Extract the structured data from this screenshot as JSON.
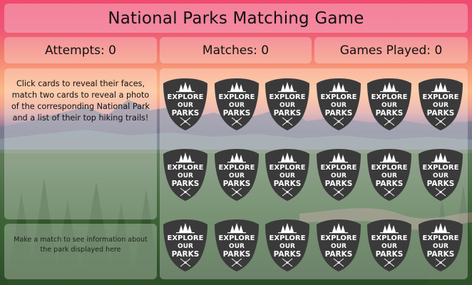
{
  "game": {
    "title": "National Parks Matching Game"
  },
  "stats": {
    "attempts_label": "Attempts: 0",
    "matches_label": "Matches: 0",
    "games_played_label": "Games Played: 0"
  },
  "instructions": {
    "text": "Click cards to reveal their faces, match two cards to reveal a photo of the corresponding National Park and a list of their top hiking trails!"
  },
  "park_info": {
    "placeholder": "Make a match to see information about the park displayed here"
  },
  "card_back": {
    "line1": "EXPLORE",
    "line2": "OUR",
    "line3": "PARKS",
    "badge_color": "#3a3a3a",
    "text_color": "#ffffff"
  },
  "board": {
    "rows": 3,
    "cols": 6,
    "cards": [
      "card-1",
      "card-2",
      "card-3",
      "card-4",
      "card-5",
      "card-6",
      "card-7",
      "card-8",
      "card-9",
      "card-10",
      "card-11",
      "card-12",
      "card-13",
      "card-14",
      "card-15",
      "card-16",
      "card-17",
      "card-18"
    ]
  },
  "colors": {
    "panel": "rgba(255,255,255,0.30)",
    "sky_top": "#f04a6e",
    "sky_mid": "#f9a07a",
    "forest": "#3f6439"
  }
}
